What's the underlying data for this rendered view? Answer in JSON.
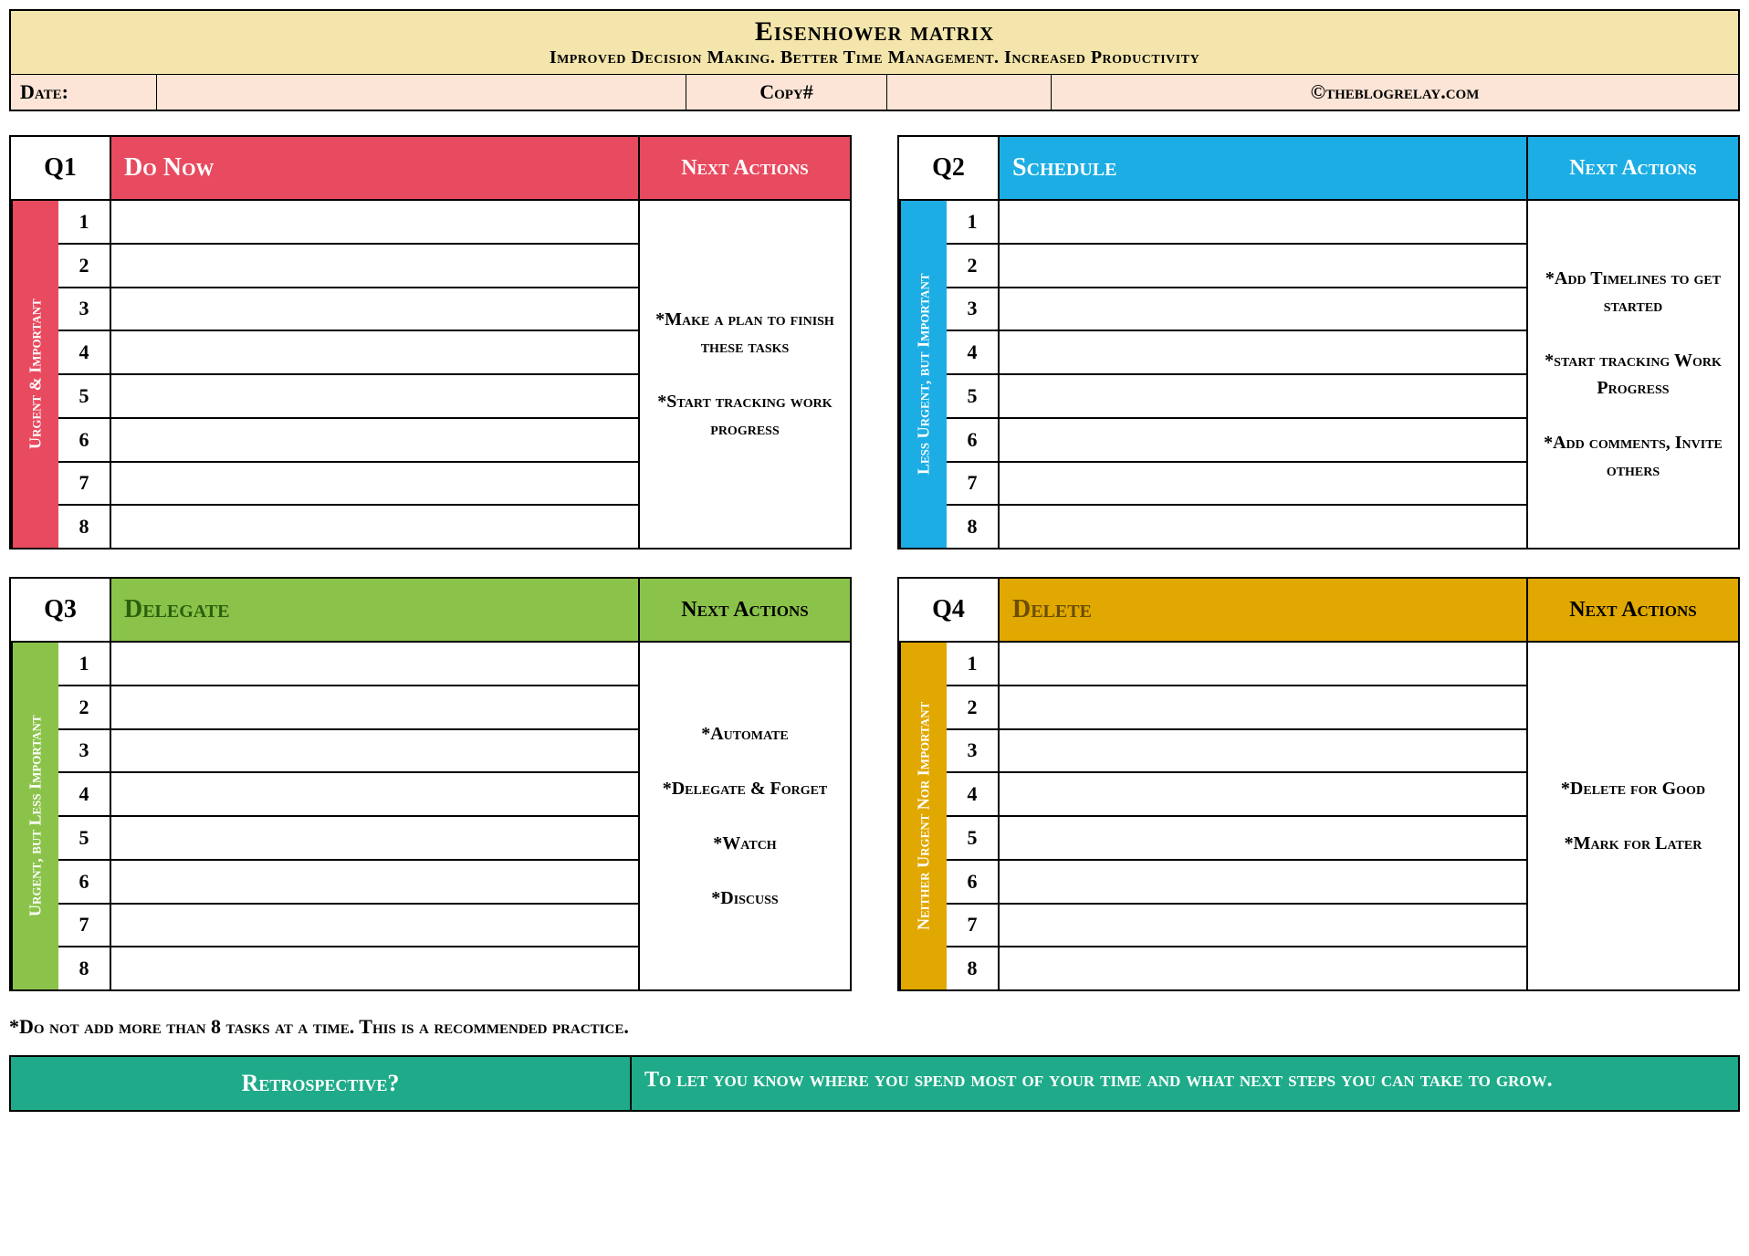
{
  "header": {
    "title": "Eisenhower matrix",
    "subtitle": "Improved Decision Making. Better Time Management. Increased Productivity",
    "date_label": "Date:",
    "date_value": "",
    "copy_label": "Copy#",
    "copy_value": "",
    "credit": "©theblogrelay.com"
  },
  "quadrants": [
    {
      "id": "Q1",
      "title": "Do Now",
      "side": "Urgent & Important",
      "next_label": "Next Actions",
      "actions": "*Make a plan to finish these tasks\n\n*Start tracking work progress",
      "rows": [
        "1",
        "2",
        "3",
        "4",
        "5",
        "6",
        "7",
        "8"
      ]
    },
    {
      "id": "Q2",
      "title": "Schedule",
      "side": "Less Urgent, but Important",
      "next_label": "Next Actions",
      "actions": "*Add Timelines to get started\n\n*start tracking Work Progress\n\n*Add comments, Invite others",
      "rows": [
        "1",
        "2",
        "3",
        "4",
        "5",
        "6",
        "7",
        "8"
      ]
    },
    {
      "id": "Q3",
      "title": "Delegate",
      "side": "Urgent, but Less Important",
      "next_label": "Next Actions",
      "actions": "*Automate\n\n*Delegate & Forget\n\n*Watch\n\n*Discuss",
      "rows": [
        "1",
        "2",
        "3",
        "4",
        "5",
        "6",
        "7",
        "8"
      ]
    },
    {
      "id": "Q4",
      "title": "Delete",
      "side": "Neither Urgent Nor Important",
      "next_label": "Next Actions",
      "actions": "*Delete for Good\n\n*Mark for Later",
      "rows": [
        "1",
        "2",
        "3",
        "4",
        "5",
        "6",
        "7",
        "8"
      ]
    }
  ],
  "footnote": "*Do not add more than 8 tasks at a time. This is a recommended practice.",
  "retro": {
    "label": "Retrospective?",
    "text": "To let you know where you spend most of your time and what next steps you can take to grow."
  }
}
